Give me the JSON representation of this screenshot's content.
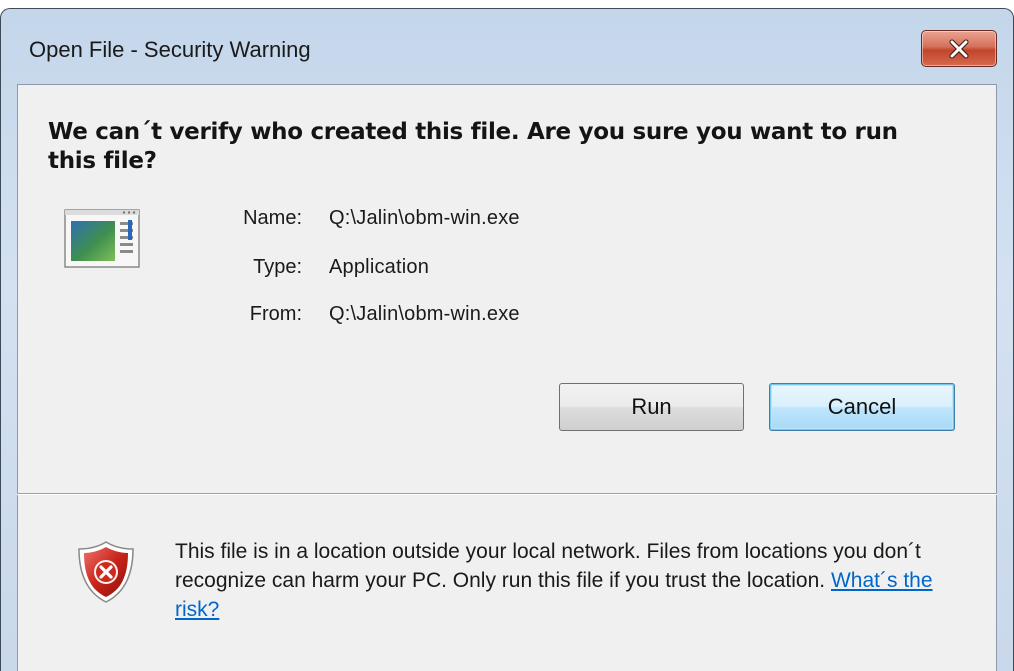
{
  "window": {
    "title": "Open File - Security Warning",
    "close_label": "Close"
  },
  "heading": "We can´t verify who created this file. Are you sure you want to run this file?",
  "file": {
    "icon": "application-window-icon",
    "name_label": "Name:",
    "name_value": "Q:\\Jalin\\obm-win.exe",
    "type_label": "Type:",
    "type_value": "Application",
    "from_label": "From:",
    "from_value": "Q:\\Jalin\\obm-win.exe"
  },
  "buttons": {
    "run": "Run",
    "cancel": "Cancel"
  },
  "footer": {
    "icon": "security-shield-error-icon",
    "message": "This file is in a location outside your local network. Files from locations you don´t recognize can harm your PC. Only run this file if you trust the location.",
    "link": "What´s the risk?"
  },
  "colors": {
    "link": "#0066cc",
    "close_button": "#c2452c",
    "shield_red": "#c8241a"
  }
}
